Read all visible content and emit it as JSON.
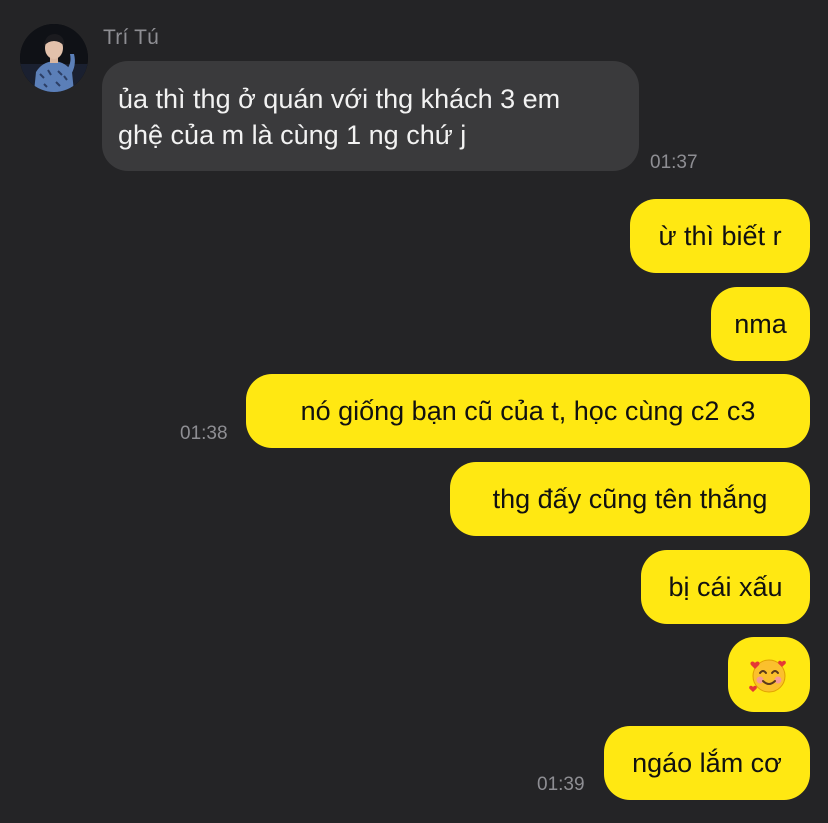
{
  "contact": {
    "name": "Trí Tú",
    "avatar_icon": "profile-photo"
  },
  "messages": [
    {
      "direction": "incoming",
      "lines": [
        "ủa thì thg ở quán với thg khách 3 em",
        "ghệ của m là cùng 1 ng chứ j"
      ],
      "time": "01:37"
    },
    {
      "direction": "outgoing",
      "text": "ừ thì biết r"
    },
    {
      "direction": "outgoing",
      "text": "nma"
    },
    {
      "direction": "outgoing",
      "text": "nó giống bạn cũ của t, học cùng c2 c3",
      "time": "01:38"
    },
    {
      "direction": "outgoing",
      "text": "thg đấy cũng tên thắng"
    },
    {
      "direction": "outgoing",
      "text": "bị cái xấu"
    },
    {
      "direction": "outgoing",
      "emoji": "smiling-face-with-hearts-icon"
    },
    {
      "direction": "outgoing",
      "text": "ngáo lắm cơ",
      "time": "01:39"
    }
  ],
  "colors": {
    "background": "#242426",
    "incoming_bubble": "#3a3a3c",
    "outgoing_bubble": "#ffe812",
    "timestamp": "#8e8e93"
  }
}
